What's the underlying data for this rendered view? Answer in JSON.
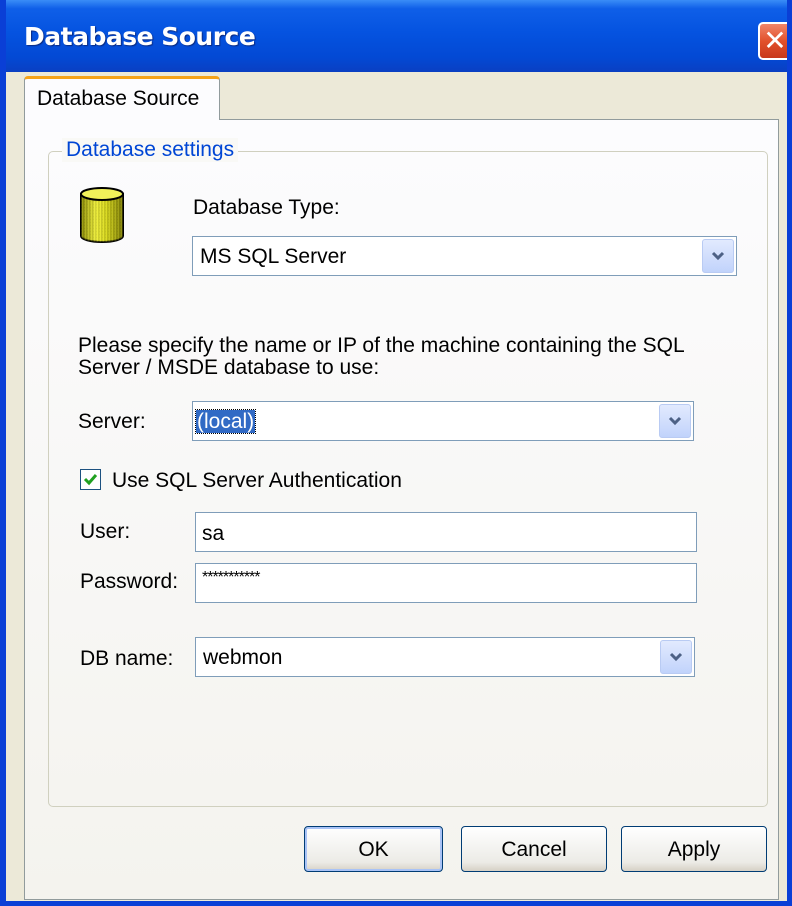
{
  "window": {
    "title": "Database Source"
  },
  "tabs": [
    {
      "label": "Database Source"
    }
  ],
  "group": {
    "label": "Database settings"
  },
  "database_type": {
    "label": "Database Type:",
    "value": "MS SQL Server"
  },
  "instructions": "Please specify the name or IP of the machine containing the SQL",
  "instructions_line2": "Server / MSDE database to use:",
  "server": {
    "label": "Server:",
    "value": "(local)"
  },
  "sql_auth": {
    "label": "Use SQL Server Authentication",
    "checked": true
  },
  "user": {
    "label": "User:",
    "value": "sa"
  },
  "password": {
    "label": "Password:",
    "value": "***********"
  },
  "db_name": {
    "label": "DB name:",
    "value": "webmon"
  },
  "buttons": {
    "ok": "OK",
    "cancel": "Cancel",
    "apply": "Apply"
  },
  "icons": {
    "close": "close-icon",
    "database": "database-icon",
    "dropdown": "chevron-down-icon",
    "check": "checkmark-icon"
  },
  "colors": {
    "titlebar": "#0553e0",
    "tab_accent": "#f5a31a",
    "group_label": "#0046d5",
    "selection": "#316ac5"
  }
}
